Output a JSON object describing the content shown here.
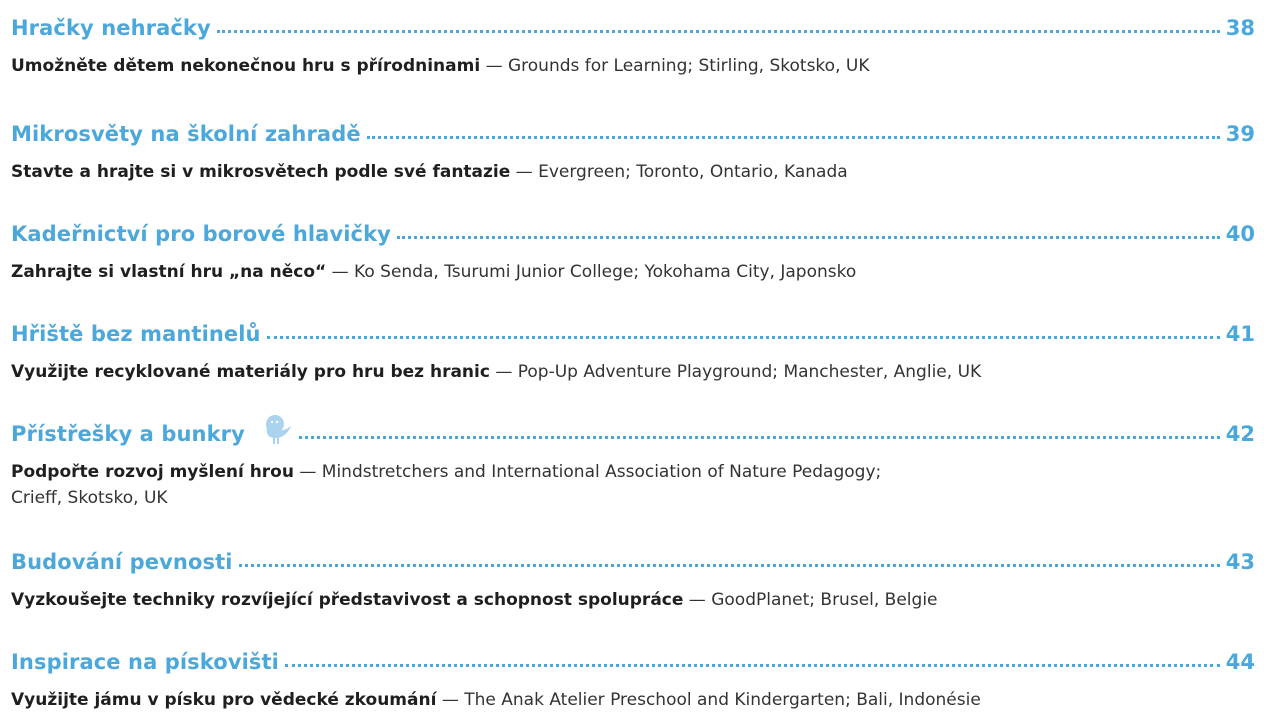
{
  "entries": [
    {
      "title": "Hračky nehračky",
      "page": "38",
      "lead": "Umožněte dětem nekonečnou hru s přírodninami",
      "separator": " — ",
      "source": "Grounds for Learning; Stirling, Skotsko, UK"
    },
    {
      "title": "Mikrosvěty na školní zahradě",
      "page": "39",
      "lead": "Stavte a hrajte si v mikrosvětech podle své fantazie",
      "separator": " — ",
      "source": "Evergreen; Toronto, Ontario, Kanada"
    },
    {
      "title": "Kadeřnictví pro borové hlavičky",
      "page": "40",
      "lead": "Zahrajte si vlastní hru „na něco“",
      "separator": " — ",
      "source": "Ko Senda, Tsurumi Junior College; Yokohama City, Japonsko"
    },
    {
      "title": "Hřiště bez mantinelů",
      "page": "41",
      "lead": "Využijte recyklované materiály pro hru bez hranic",
      "separator": " — ",
      "source": "Pop-Up Adventure Playground; Manchester, Anglie, UK"
    },
    {
      "title": "Přístřešky a bunkry",
      "page": "42",
      "icon": "bird-icon",
      "lead": "Podpořte rozvoj myšlení hrou",
      "separator": " — ",
      "source": "Mindstretchers and International Association of Nature Pedagogy;",
      "source_line2": "Crieff, Skotsko, UK"
    },
    {
      "title": "Budování pevnosti",
      "page": "43",
      "lead": "Vyzkoušejte techniky rozvíjející představivost a schopnost spolupráce",
      "separator": " — ",
      "source": "GoodPlanet; Brusel, Belgie"
    },
    {
      "title": "Inspirace na pískovišti",
      "page": "44",
      "lead": "Využijte jámu v písku pro vědecké zkoumání",
      "separator": " — ",
      "source": "The Anak Atelier Preschool and Kindergarten; Bali, Indonésie"
    }
  ],
  "colors": {
    "accent": "#4aa8dc",
    "text": "#1f1f1f",
    "bird": "#a9d3ee"
  }
}
